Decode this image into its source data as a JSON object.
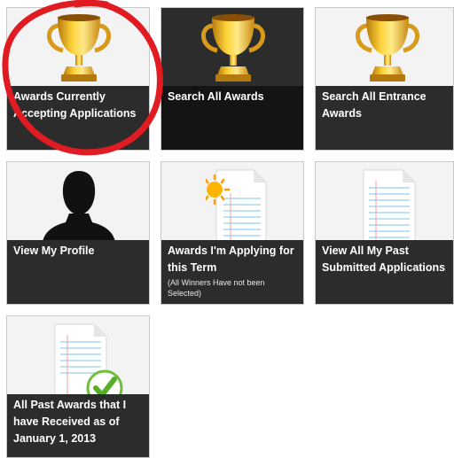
{
  "tiles": [
    {
      "id": "awards-currently-accepting",
      "title": "Awards Currently Accepting Applications",
      "subtitle": "",
      "icon": "trophy-icon"
    },
    {
      "id": "search-all-awards",
      "title": "Search All Awards",
      "subtitle": "",
      "icon": "trophy-icon"
    },
    {
      "id": "search-all-entrance-awards",
      "title": "Search All Entrance Awards",
      "subtitle": "",
      "icon": "trophy-icon"
    },
    {
      "id": "view-my-profile",
      "title": "View My Profile",
      "subtitle": "",
      "icon": "person-silhouette-icon"
    },
    {
      "id": "awards-applying-this-term",
      "title": "Awards I'm Applying for this Term",
      "subtitle": "(All Winners Have not been Selected)",
      "icon": "document-sun-icon"
    },
    {
      "id": "view-past-submitted",
      "title": "View All My Past Submitted Applications",
      "subtitle": "",
      "icon": "document-icon"
    },
    {
      "id": "past-awards-received",
      "title": "All Past Awards that I have Received as of January 1, 2013",
      "subtitle": "",
      "icon": "document-checkmark-icon"
    }
  ],
  "annotation": {
    "shape": "hand-drawn-circle",
    "color": "#e11b22"
  },
  "colors": {
    "caption_bg": "#2c2c2c",
    "tile_bg": "#f3f3f3",
    "caption_text": "#ffffff"
  }
}
